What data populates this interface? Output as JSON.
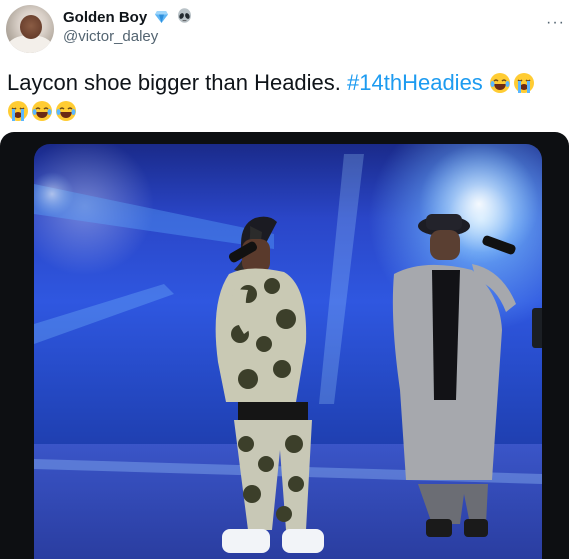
{
  "tweet": {
    "author": {
      "name": "Golden Boy",
      "handle": "@victor_daley",
      "badges": [
        "blue-diamond-icon",
        "alien-icon"
      ]
    },
    "more_label": "···",
    "text": "Laycon shoe bigger than Headies.",
    "hashtag": "#14thHeadies",
    "emojis_line1": [
      "joy-emoji",
      "sob-emoji"
    ],
    "emojis_line2": [
      "sob-emoji",
      "joy-emoji",
      "joy-emoji"
    ]
  },
  "colors": {
    "hashtag": "#1d9bf0",
    "text": "#0f1419",
    "muted": "#536471"
  }
}
